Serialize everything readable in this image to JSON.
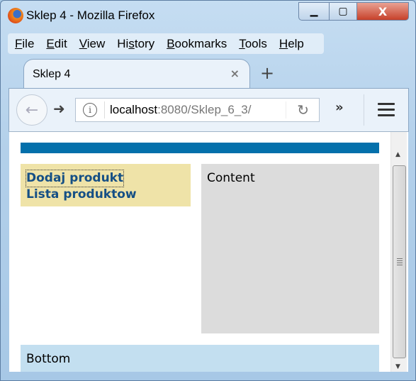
{
  "window": {
    "title": "Sklep 4 - Mozilla Firefox",
    "controls": {
      "minimize": "minimize-icon",
      "maximize": "maximize-icon",
      "close": "close-icon"
    }
  },
  "menubar": [
    {
      "label": "File",
      "key": "F",
      "rest": "ile"
    },
    {
      "label": "Edit",
      "key": "E",
      "rest": "dit"
    },
    {
      "label": "View",
      "key": "V",
      "rest": "iew"
    },
    {
      "label": "History",
      "pre": "Hi",
      "key": "s",
      "rest": "tory"
    },
    {
      "label": "Bookmarks",
      "key": "B",
      "rest": "ookmarks"
    },
    {
      "label": "Tools",
      "key": "T",
      "rest": "ools"
    },
    {
      "label": "Help",
      "key": "H",
      "rest": "elp"
    }
  ],
  "tab": {
    "title": "Sklep 4",
    "close": "×",
    "new_tab": "+"
  },
  "nav": {
    "url_host": "localhost",
    "url_rest": ":8080/Sklep_6_3/",
    "info": "i",
    "reload": "↻",
    "overflow": "»",
    "back": "←",
    "forward": "➜"
  },
  "page": {
    "colors": {
      "header": "#0470ab",
      "menu": "#efe3a8",
      "content": "#dcdcdc",
      "bottom": "#c3dff0",
      "link": "#154f85"
    },
    "menu": [
      {
        "label": "Dodaj produkt",
        "focused": true
      },
      {
        "label": "Lista produktow",
        "focused": false
      }
    ],
    "content": "Content",
    "bottom": "Bottom"
  }
}
